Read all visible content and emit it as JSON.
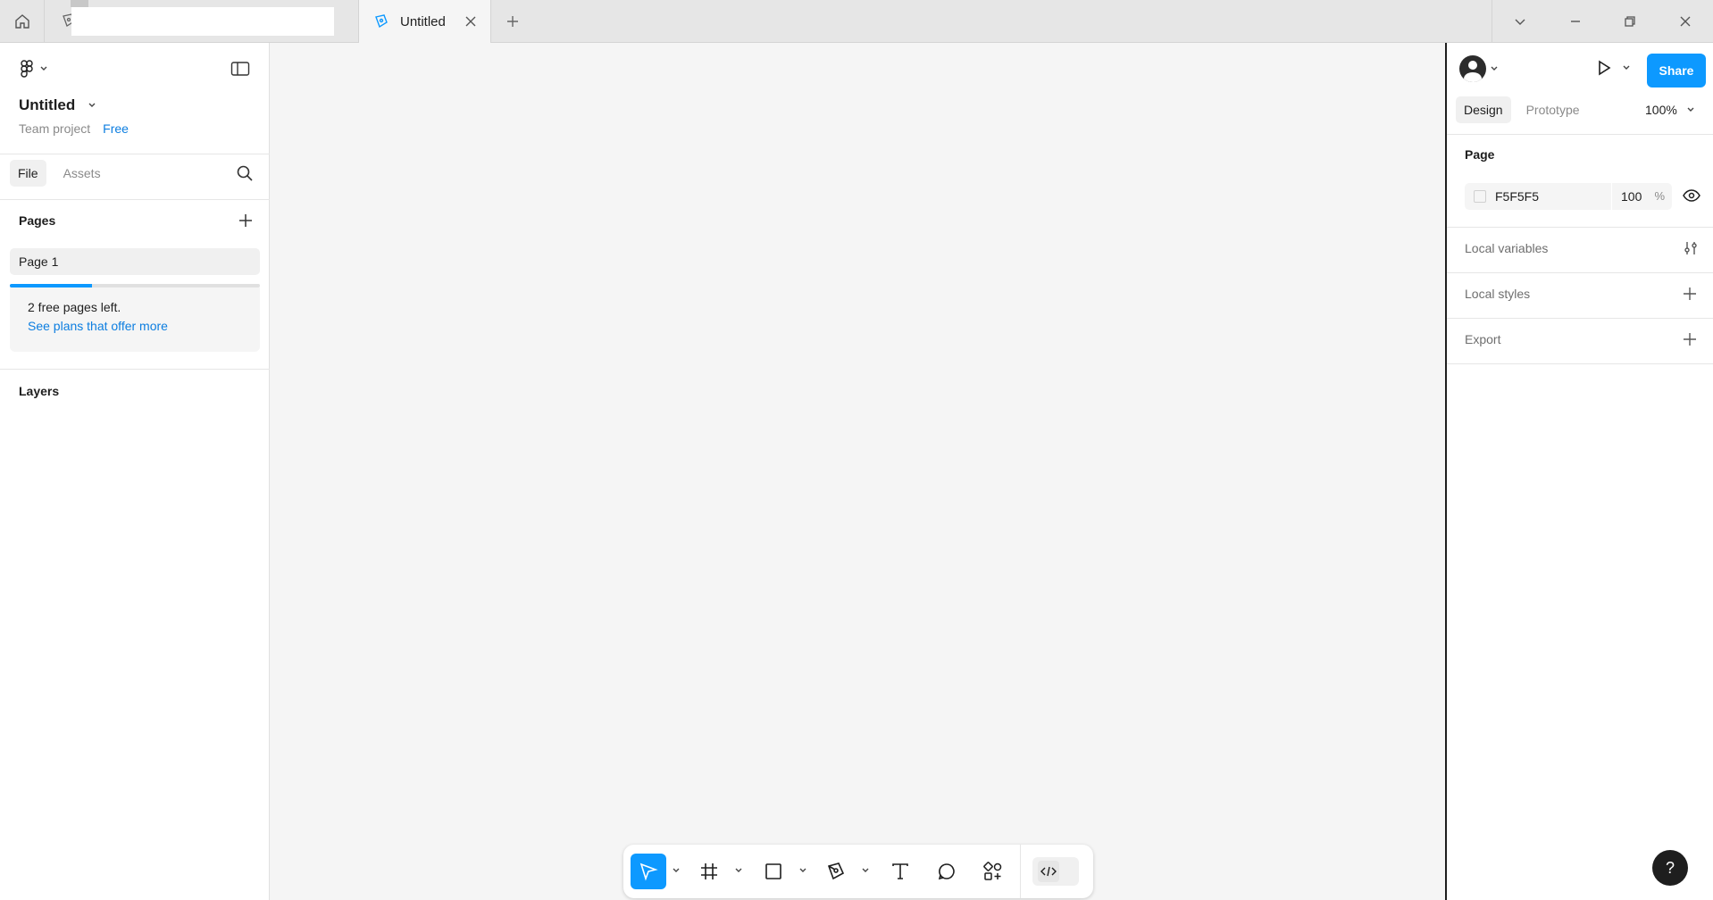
{
  "titlebar": {
    "tab_title": "Untitled"
  },
  "left_panel": {
    "doc_title": "Untitled",
    "team": "Team project",
    "plan": "Free",
    "tabs": [
      "File",
      "Assets"
    ],
    "pages_heading": "Pages",
    "pages": [
      "Page 1"
    ],
    "free_pages_used_fraction": 0.33,
    "upsell_line1": "2 free pages left.",
    "upsell_link": "See plans that offer more",
    "layers_heading": "Layers"
  },
  "right_panel": {
    "share_label": "Share",
    "tabs": [
      "Design",
      "Prototype"
    ],
    "zoom": "100%",
    "page_heading": "Page",
    "fill_hex": "F5F5F5",
    "fill_opacity": "100",
    "fill_pct_sign": "%",
    "sections": [
      "Local variables",
      "Local styles",
      "Export"
    ]
  },
  "toolbar": {
    "tools": [
      "move-tool",
      "frame-tool",
      "rectangle-tool",
      "pen-tool",
      "text-tool",
      "comment-tool",
      "actions-tool",
      "dev-mode-toggle"
    ]
  },
  "help_label": "?",
  "colors": {
    "accent": "#0d99ff",
    "canvas": "#f5f5f5",
    "link": "#0d7ee0"
  }
}
